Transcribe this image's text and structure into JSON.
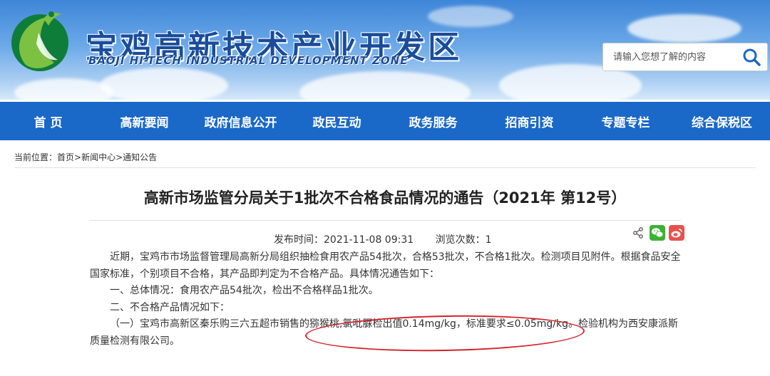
{
  "header": {
    "site_title": "宝鸡高新技术产业开发区",
    "site_subtitle": "BAOJI HI-TECH INDUSTRIAL DEVELOPMENT ZONE",
    "search_placeholder": "请输入您想了解的内容",
    "search_icon": "search-icon",
    "logo_icon": "logo-icon"
  },
  "nav": {
    "items": [
      "首 页",
      "高新要闻",
      "政府信息公开",
      "政民互动",
      "政务服务",
      "招商引资",
      "专题专栏",
      "综合保税区"
    ]
  },
  "breadcrumb": {
    "prefix": "当前位置：",
    "items": [
      "首页",
      "新闻中心",
      "通知公告"
    ],
    "separator": ">"
  },
  "article": {
    "title": "高新市场监管分局关于1批次不合格食品情况的通告（2021年 第12号）",
    "publish_label": "发布时间：",
    "publish_time": "2021-11-08 09:31",
    "views_label": "浏览次数：",
    "views": "1",
    "share_icons": [
      "share-icon",
      "wechat-icon",
      "weibo-icon"
    ],
    "paragraphs": [
      "近期，宝鸡市市场监督管理局高新分局组织抽检食用农产品54批次，合格53批次，不合格1批次。检测项目见附件。根据食品安全国家标准，个别项目不合格，其产品即判定为不合格产品。具体情况通告如下：",
      "一、总体情况：食用农产品54批次，检出不合格样品1批次。",
      "二、不合格产品情况如下：",
      "（一）宝鸡市高新区秦乐购三六五超市销售的猕猴桃,氯吡脲检出值0.14mg/kg，标准要求≤0.05mg/kg。检验机构为西安康派斯质量检测有限公司。"
    ]
  },
  "colors": {
    "nav_bg": "#1a68c8",
    "title_blue": "#1a4c9a",
    "annotation_red": "#d6222a"
  }
}
